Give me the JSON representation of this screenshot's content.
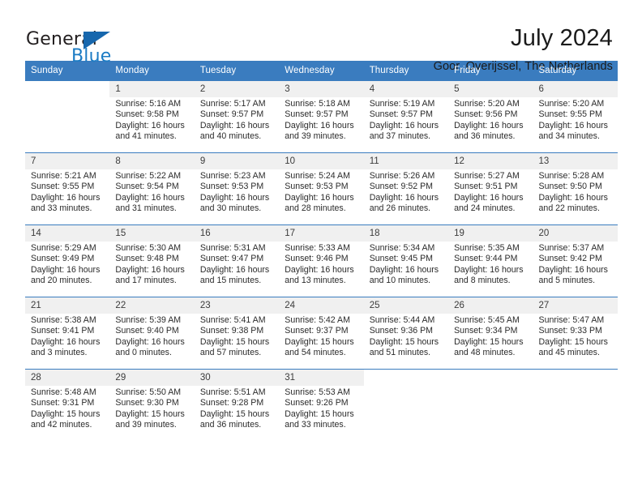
{
  "brand": {
    "name_part1": "General",
    "name_part2": "Blue",
    "flag_icon": "triangle-flag-icon"
  },
  "header": {
    "title": "July 2024",
    "location": "Goor, Overijssel, The Netherlands"
  },
  "colors": {
    "header_bar": "#3a7cbf",
    "brand_blue": "#1b7bc4",
    "daynum_band": "#f0f0f0",
    "text": "#2b2b2b"
  },
  "calendar": {
    "weekday_headers": [
      "Sunday",
      "Monday",
      "Tuesday",
      "Wednesday",
      "Thursday",
      "Friday",
      "Saturday"
    ],
    "weeks": [
      [
        {
          "day": "",
          "info": "",
          "empty": true
        },
        {
          "day": "1",
          "info": "Sunrise: 5:16 AM\nSunset: 9:58 PM\nDaylight: 16 hours\nand 41 minutes."
        },
        {
          "day": "2",
          "info": "Sunrise: 5:17 AM\nSunset: 9:57 PM\nDaylight: 16 hours\nand 40 minutes."
        },
        {
          "day": "3",
          "info": "Sunrise: 5:18 AM\nSunset: 9:57 PM\nDaylight: 16 hours\nand 39 minutes."
        },
        {
          "day": "4",
          "info": "Sunrise: 5:19 AM\nSunset: 9:57 PM\nDaylight: 16 hours\nand 37 minutes."
        },
        {
          "day": "5",
          "info": "Sunrise: 5:20 AM\nSunset: 9:56 PM\nDaylight: 16 hours\nand 36 minutes."
        },
        {
          "day": "6",
          "info": "Sunrise: 5:20 AM\nSunset: 9:55 PM\nDaylight: 16 hours\nand 34 minutes."
        }
      ],
      [
        {
          "day": "7",
          "info": "Sunrise: 5:21 AM\nSunset: 9:55 PM\nDaylight: 16 hours\nand 33 minutes."
        },
        {
          "day": "8",
          "info": "Sunrise: 5:22 AM\nSunset: 9:54 PM\nDaylight: 16 hours\nand 31 minutes."
        },
        {
          "day": "9",
          "info": "Sunrise: 5:23 AM\nSunset: 9:53 PM\nDaylight: 16 hours\nand 30 minutes."
        },
        {
          "day": "10",
          "info": "Sunrise: 5:24 AM\nSunset: 9:53 PM\nDaylight: 16 hours\nand 28 minutes."
        },
        {
          "day": "11",
          "info": "Sunrise: 5:26 AM\nSunset: 9:52 PM\nDaylight: 16 hours\nand 26 minutes."
        },
        {
          "day": "12",
          "info": "Sunrise: 5:27 AM\nSunset: 9:51 PM\nDaylight: 16 hours\nand 24 minutes."
        },
        {
          "day": "13",
          "info": "Sunrise: 5:28 AM\nSunset: 9:50 PM\nDaylight: 16 hours\nand 22 minutes."
        }
      ],
      [
        {
          "day": "14",
          "info": "Sunrise: 5:29 AM\nSunset: 9:49 PM\nDaylight: 16 hours\nand 20 minutes."
        },
        {
          "day": "15",
          "info": "Sunrise: 5:30 AM\nSunset: 9:48 PM\nDaylight: 16 hours\nand 17 minutes."
        },
        {
          "day": "16",
          "info": "Sunrise: 5:31 AM\nSunset: 9:47 PM\nDaylight: 16 hours\nand 15 minutes."
        },
        {
          "day": "17",
          "info": "Sunrise: 5:33 AM\nSunset: 9:46 PM\nDaylight: 16 hours\nand 13 minutes."
        },
        {
          "day": "18",
          "info": "Sunrise: 5:34 AM\nSunset: 9:45 PM\nDaylight: 16 hours\nand 10 minutes."
        },
        {
          "day": "19",
          "info": "Sunrise: 5:35 AM\nSunset: 9:44 PM\nDaylight: 16 hours\nand 8 minutes."
        },
        {
          "day": "20",
          "info": "Sunrise: 5:37 AM\nSunset: 9:42 PM\nDaylight: 16 hours\nand 5 minutes."
        }
      ],
      [
        {
          "day": "21",
          "info": "Sunrise: 5:38 AM\nSunset: 9:41 PM\nDaylight: 16 hours\nand 3 minutes."
        },
        {
          "day": "22",
          "info": "Sunrise: 5:39 AM\nSunset: 9:40 PM\nDaylight: 16 hours\nand 0 minutes."
        },
        {
          "day": "23",
          "info": "Sunrise: 5:41 AM\nSunset: 9:38 PM\nDaylight: 15 hours\nand 57 minutes."
        },
        {
          "day": "24",
          "info": "Sunrise: 5:42 AM\nSunset: 9:37 PM\nDaylight: 15 hours\nand 54 minutes."
        },
        {
          "day": "25",
          "info": "Sunrise: 5:44 AM\nSunset: 9:36 PM\nDaylight: 15 hours\nand 51 minutes."
        },
        {
          "day": "26",
          "info": "Sunrise: 5:45 AM\nSunset: 9:34 PM\nDaylight: 15 hours\nand 48 minutes."
        },
        {
          "day": "27",
          "info": "Sunrise: 5:47 AM\nSunset: 9:33 PM\nDaylight: 15 hours\nand 45 minutes."
        }
      ],
      [
        {
          "day": "28",
          "info": "Sunrise: 5:48 AM\nSunset: 9:31 PM\nDaylight: 15 hours\nand 42 minutes."
        },
        {
          "day": "29",
          "info": "Sunrise: 5:50 AM\nSunset: 9:30 PM\nDaylight: 15 hours\nand 39 minutes."
        },
        {
          "day": "30",
          "info": "Sunrise: 5:51 AM\nSunset: 9:28 PM\nDaylight: 15 hours\nand 36 minutes."
        },
        {
          "day": "31",
          "info": "Sunrise: 5:53 AM\nSunset: 9:26 PM\nDaylight: 15 hours\nand 33 minutes."
        },
        {
          "day": "",
          "info": "",
          "empty": true
        },
        {
          "day": "",
          "info": "",
          "empty": true
        },
        {
          "day": "",
          "info": "",
          "empty": true
        }
      ]
    ]
  }
}
